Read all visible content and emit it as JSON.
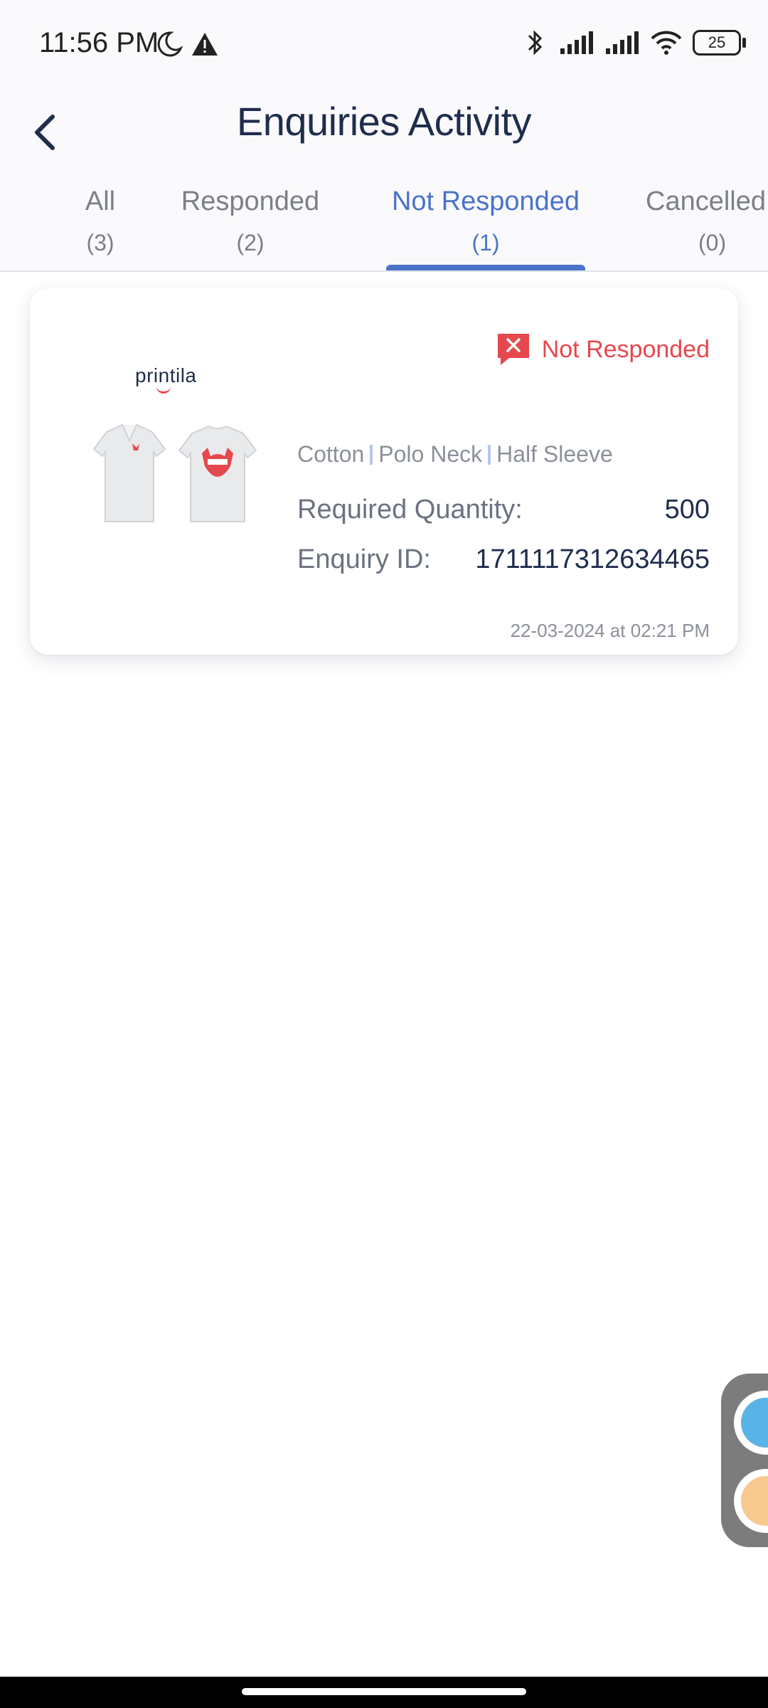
{
  "status_bar": {
    "time": "11:56 PM",
    "battery": "25",
    "icons": [
      "moon-icon",
      "warning-icon",
      "bluetooth-icon",
      "signal-icon",
      "signal-icon",
      "wifi-icon",
      "battery-icon"
    ]
  },
  "header": {
    "title": "Enquiries Activity",
    "back_icon": "chevron-left-icon"
  },
  "tabs": [
    {
      "label": "All",
      "count": "(3)",
      "active": false
    },
    {
      "label": "Responded",
      "count": "(2)",
      "active": false
    },
    {
      "label": "Not Responded",
      "count": "(1)",
      "active": true
    },
    {
      "label": "Cancelled",
      "count": "(0)",
      "active": false
    }
  ],
  "enquiry": {
    "status": "Not Responded",
    "status_color": "#e5484d",
    "brand": "printila",
    "specs": [
      "Cotton",
      "Polo Neck",
      "Half Sleeve"
    ],
    "quantity_label": "Required Quantity:",
    "quantity_value": "500",
    "id_label": "Enquiry ID:",
    "id_value": "1711117312634465",
    "timestamp": "22-03-2024 at 02:21 PM"
  },
  "colors": {
    "accent": "#4a73c9",
    "title": "#1f2d4d",
    "danger": "#e5484d"
  }
}
